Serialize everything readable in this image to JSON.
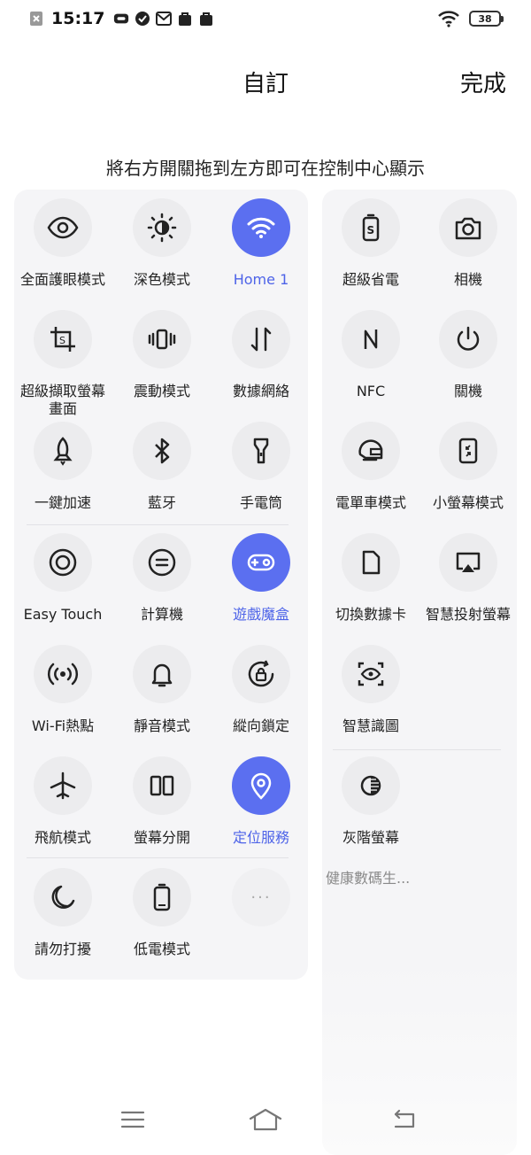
{
  "status": {
    "time": "15:17",
    "battery": "38",
    "icons": [
      "close-notification-icon",
      "link-icon",
      "check-icon",
      "mail-icon",
      "bag-icon",
      "bag-icon"
    ]
  },
  "header": {
    "title": "自訂",
    "done_label": "完成"
  },
  "hint": "將右方開關拖到左方即可在控制中心顯示",
  "colors": {
    "accent": "#5b6ff0",
    "accent_text": "#4d63e8",
    "circle_bg": "#ececee",
    "panel_bg": "#f5f5f7"
  },
  "left_tiles": [
    {
      "label": "全面護眼模式",
      "icon": "eye-icon",
      "active": false
    },
    {
      "label": "深色模式",
      "icon": "dark-mode-icon",
      "active": false
    },
    {
      "label": "Home 1",
      "icon": "wifi-icon",
      "active": true
    },
    {
      "label": "超級擷取螢幕畫面",
      "icon": "screenshot-icon",
      "active": false
    },
    {
      "label": "震動模式",
      "icon": "vibrate-icon",
      "active": false
    },
    {
      "label": "數據網絡",
      "icon": "mobile-data-icon",
      "active": false
    },
    {
      "label": "一鍵加速",
      "icon": "rocket-icon",
      "active": false
    },
    {
      "label": "藍牙",
      "icon": "bluetooth-icon",
      "active": false
    },
    {
      "label": "手電筒",
      "icon": "flashlight-icon",
      "active": false
    },
    {
      "label": "Easy Touch",
      "icon": "easy-touch-icon",
      "active": false
    },
    {
      "label": "計算機",
      "icon": "calculator-icon",
      "active": false
    },
    {
      "label": "遊戲魔盒",
      "icon": "gamepad-icon",
      "active": true
    },
    {
      "label": "Wi-Fi熱點",
      "icon": "hotspot-icon",
      "active": false
    },
    {
      "label": "靜音模式",
      "icon": "bell-icon",
      "active": false
    },
    {
      "label": "縱向鎖定",
      "icon": "rotation-lock-icon",
      "active": false
    },
    {
      "label": "飛航模式",
      "icon": "airplane-icon",
      "active": false
    },
    {
      "label": "螢幕分開",
      "icon": "split-screen-icon",
      "active": false
    },
    {
      "label": "定位服務",
      "icon": "location-icon",
      "active": true
    },
    {
      "label": "請勿打擾",
      "icon": "moon-icon",
      "active": false
    },
    {
      "label": "低電模式",
      "icon": "battery-icon",
      "active": false
    },
    {
      "label": "",
      "icon": "more-icon",
      "active": false
    }
  ],
  "right_tiles": [
    {
      "label": "超級省電",
      "icon": "power-saving-icon"
    },
    {
      "label": "相機",
      "icon": "camera-icon"
    },
    {
      "label": "NFC",
      "icon": "nfc-icon"
    },
    {
      "label": "關機",
      "icon": "power-icon"
    },
    {
      "label": "電單車模式",
      "icon": "helmet-icon"
    },
    {
      "label": "小螢幕模式",
      "icon": "small-screen-icon"
    },
    {
      "label": "切換數據卡",
      "icon": "sim-card-icon"
    },
    {
      "label": "智慧投射螢幕",
      "icon": "screen-cast-icon"
    },
    {
      "label": "智慧識圖",
      "icon": "visual-search-icon"
    },
    {
      "label": "灰階螢幕",
      "icon": "grayscale-icon"
    }
  ],
  "right_more": "健康數碼生...",
  "more_dots": "···"
}
